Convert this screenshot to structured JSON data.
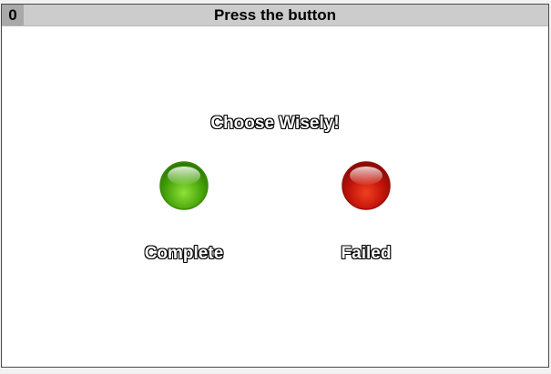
{
  "window": {
    "counter": "0",
    "title": "Press the button"
  },
  "main": {
    "prompt": "Choose Wisely!",
    "buttons": [
      {
        "label": "Complete",
        "color": "#4caf12"
      },
      {
        "label": "Failed",
        "color": "#c8140a"
      }
    ]
  }
}
